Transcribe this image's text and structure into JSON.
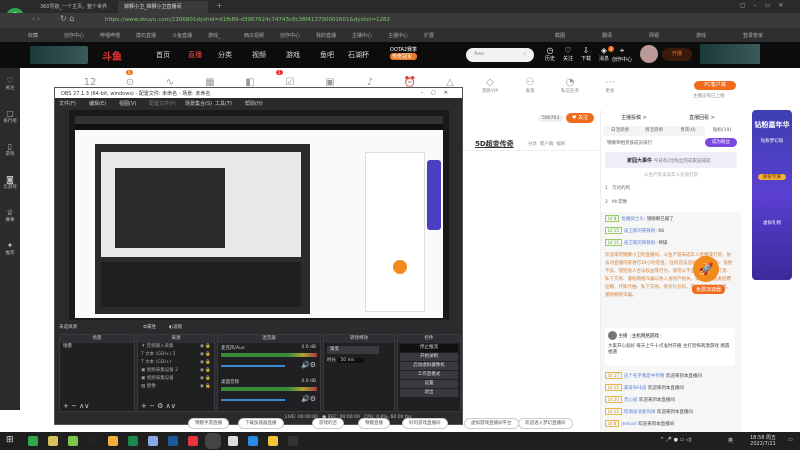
{
  "browser": {
    "tabs": [
      "360导航_一个主页，整个世界",
      "锦狮小卫_锦狮小卫直播间"
    ],
    "url": "https://www.douyu.com/2306801dyshid=d1fb89-d3967624c74743c8c38f413700001601&dyshci=1282",
    "bookmarks": [
      "收藏",
      "创作中心",
      "哔哩哔哩",
      "摸石直播",
      "斗鱼直播",
      "游戏_",
      "西瓜视频",
      "创作中心",
      "我的直播",
      "主播中心",
      "主播中心",
      "扩展",
      "截图",
      "翻译",
      "网银",
      "游戏",
      "登录管家"
    ]
  },
  "douyu": {
    "nav": [
      "首页",
      "直播",
      "分类",
      "视频",
      "游戏",
      "鱼吧",
      "石湖杯"
    ],
    "banner_text": "DOTA2赛季",
    "banner_sub": "传奇冠军",
    "search_placeholder": "Awo",
    "icons": [
      "历史",
      "关注",
      "下载",
      "消息",
      "创作中心"
    ],
    "msg_badge": "3",
    "live_btn": "开播",
    "sidebar": [
      "关注",
      "排行榜",
      "游戏",
      "云游戏",
      "赛事",
      "推荐"
    ],
    "tools": [
      "",
      "",
      "",
      "",
      "",
      "",
      "",
      "",
      "开播提醒",
      "挂机助机",
      "贵族VIP",
      "发现",
      "私信任务",
      "更多"
    ],
    "tool_number": "12",
    "tool_badges": [
      "6",
      "1"
    ],
    "pc_btn": "PC客户端",
    "pc_sub": "主播没有已上线",
    "follow_count": "590703",
    "follow_btn": "关注",
    "room_title": "5D超变传奇",
    "share": "分享",
    "client": "客户端",
    "welfare": "福利"
  },
  "obs": {
    "title": "OBS 27.1.3 (64-bit, windows) - 配置文件: 未命名 - 场景: 未命名",
    "menu": [
      "文件(F)",
      "编辑(E)",
      "视图(V)",
      "配置文件(P)",
      "场景集合(S)",
      "工具(T)",
      "帮助(H)"
    ],
    "no_source": "未选择源",
    "props": "属性",
    "filters": "滤镜",
    "panels": [
      "场景",
      "来源",
      "混音器",
      "转场特效",
      "控件"
    ],
    "scenes": [
      "场景"
    ],
    "sources": [
      "音频输入采集",
      "文本 (GDI+) 2",
      "文本 (GDI+)",
      "视频采集设备 2",
      "视频采集设备",
      "图像"
    ],
    "mixer": [
      {
        "name": "麦克风/Aux",
        "db": "0.0 dB"
      },
      {
        "name": "桌面音频",
        "db": "0.0 dB"
      }
    ],
    "transition": "渐变",
    "duration_label": "时长",
    "duration": "50 ms",
    "controls": [
      "停止推流",
      "开始录制",
      "启动虚拟摄像机",
      "工作室模式",
      "设置",
      "退出"
    ],
    "status": {
      "live": "LIVE: 00:00:00",
      "rec": "REC: 00:00:00",
      "cpu": "CPU: 0.6%, 60.00 fps"
    }
  },
  "chat": {
    "top": [
      "主播投稿 >",
      "直播回看 >"
    ],
    "tabs": [
      "日活跃榜",
      "周活跃榜",
      "贵宾(0)",
      "贴粉(19)"
    ],
    "rank_title": "锦狮宰相贵族成员排行",
    "join_btn": "成为粉丝",
    "event": "家园大事件",
    "event_text": "今日有2位粉丝完成家园成就",
    "notice": "斗鱼严禁未成年人充值打赏",
    "ranks": [
      {
        "n": "1",
        "name": "乃达的鸡"
      },
      {
        "n": "2",
        "name": "Mr李豫"
      }
    ],
    "messages": [
      {
        "lv": "LV 8",
        "name": "优雅骑士头:",
        "text": "锁眼眼已服了"
      },
      {
        "lv": "LV 15",
        "name": "奋卫家的铁铁粉:",
        "text": "66"
      },
      {
        "lv": "LV 15",
        "name": "奋卫家的铁铁粉:",
        "text": "神操"
      }
    ],
    "system": "欢迎来到锦狮小卫的直播间。斗鱼严禁未成年人直播或打赏。依法对直播内容进行24小时巡查，任何违法违规、色情暴力、低俗不良、侵犯他人合法权益等行为，请勿以不正当方式诱导打赏、私下交易、谨防网络诈骗以防人身财产损失。请勿轻信各类招聘征婚、代练代抽、私下交易、购买礼包码、游戏币等广告信息，谨防网络诈骗。",
    "accel": "免费加速器",
    "anchor_label": "主播",
    "anchor_tag": "主机网络游戏",
    "anchor_text": "大家开心就好 每天上午十点准时开播 主打恐怖刺激游戏 偶遇相遇",
    "welcomes": [
      {
        "lv": "LV 17",
        "name": "这个名字我是中奖啊",
        "text": "欢迎来到本直播间"
      },
      {
        "lv": "LV 15",
        "name": "豪爱咔咔迪",
        "text": "欢迎来到本直播间"
      },
      {
        "lv": "LV 20",
        "name": "无心居",
        "text": "欢迎来到本直播间"
      },
      {
        "lv": "LV 12",
        "name": "瑶湖泳池爱热闹",
        "text": "欢迎来到本直播间"
      },
      {
        "lv": "LV 8",
        "name": "Jenkarl",
        "text": "欢迎来到本直播间"
      }
    ]
  },
  "ad": {
    "title": "钻粉嘉年华",
    "sub": "钻粉梦幻翁",
    "btn": "解锁专属",
    "footer": "虚拟礼物"
  },
  "pills": [
    "锦鲤手游直播",
    "下载加速器直播",
    "游戏的咨",
    "锦鲤直播",
    "好的游戏直播间",
    "虚拟游戏直播间平台",
    "欢迎进入梦幻直播间"
  ],
  "taskbar": {
    "time": "18:58 周五",
    "date": "2022/7/21",
    "ime": "英"
  },
  "colors": {
    "accent": "#f26b1d",
    "nav_bg": "#0c0c0c",
    "obs_bg": "#2b2b2e",
    "purple": "#5a3fd0"
  }
}
